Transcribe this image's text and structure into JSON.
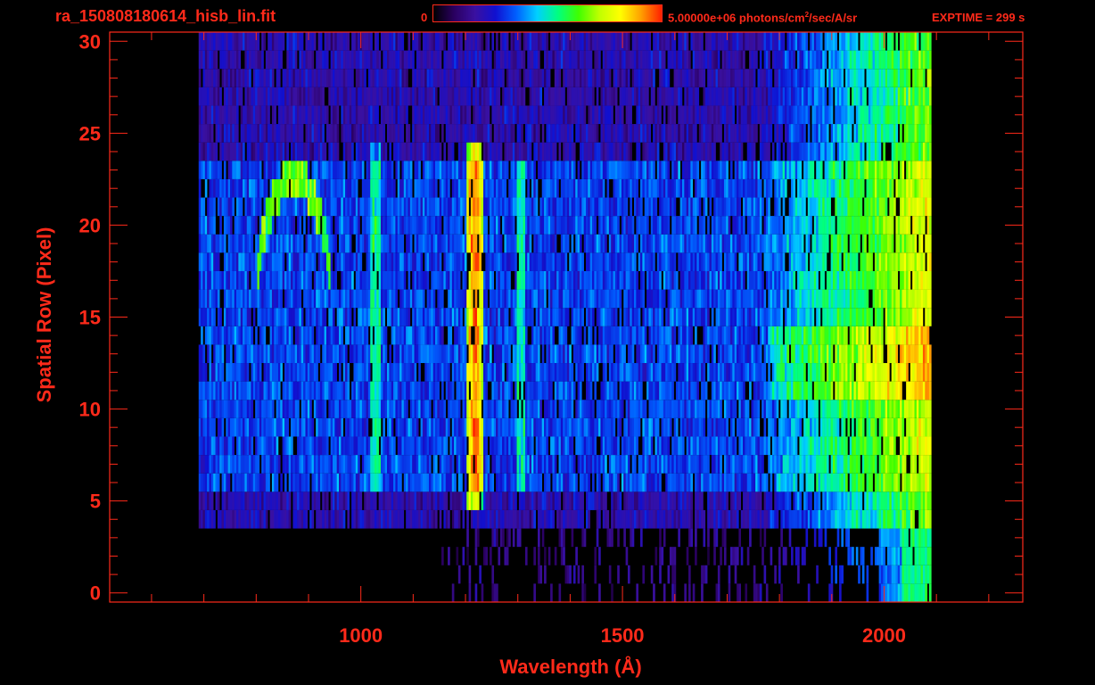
{
  "header": {
    "filename": "ra_150808180614_hisb_lin.fit",
    "colorbar_min": "0",
    "colorbar_max_value": "5.00000e+06 photons/cm",
    "colorbar_max_sup": "2",
    "colorbar_max_unit": "/sec/A/sr",
    "exptime": "EXPTIME = 299 s"
  },
  "colors": {
    "axis": "#ff2a1a",
    "background": "#000000",
    "colormap": [
      "#000000",
      "#2a0060",
      "#3a10a0",
      "#1010d0",
      "#0060ff",
      "#00d0ff",
      "#00ff80",
      "#40ff00",
      "#c0ff00",
      "#ffff00",
      "#ffa000",
      "#ff2000"
    ]
  },
  "chart_data": {
    "type": "heatmap",
    "title": "ra_150808180614_hisb_lin.fit",
    "xlabel": "Wavelength (Å)",
    "ylabel": "Spatial Row (Pixel)",
    "xlim": [
      520,
      2265
    ],
    "ylim": [
      -0.5,
      30.5
    ],
    "xticks": [
      1000,
      1500,
      2000
    ],
    "xtick_labels": [
      "1000",
      "1500",
      "2000"
    ],
    "yticks": [
      0,
      5,
      10,
      15,
      20,
      25,
      30
    ],
    "ytick_labels": [
      "0",
      "5",
      "10",
      "15",
      "20",
      "25",
      "30"
    ],
    "colorbar": {
      "min": 0,
      "max": 5000000,
      "units": "photons/cm2/sec/A/sr"
    },
    "data_extent": {
      "x_min": 690,
      "x_max": 2090,
      "y_min": 0,
      "y_max": 30
    },
    "features": [
      {
        "name": "Lyman-alpha emission",
        "x": 1216,
        "rows": [
          5,
          24
        ],
        "peak_intensity": 0.95
      },
      {
        "name": "OI emission",
        "x": 1304,
        "rows": [
          6,
          23
        ],
        "peak_intensity": 0.45
      },
      {
        "name": "Lyman-beta region",
        "x": 1026,
        "rows": [
          6,
          24
        ],
        "peak_intensity": 0.42
      },
      {
        "name": "arc feature",
        "x": [
          820,
          930
        ],
        "rows": [
          13,
          23
        ],
        "peak_intensity": 0.62
      },
      {
        "name": "long-wavelength continuum",
        "x": [
          1800,
          2060
        ],
        "rows": [
          3,
          30
        ],
        "peak_intensity": 0.7
      }
    ],
    "grid": false,
    "legend": "colorbar-top"
  }
}
